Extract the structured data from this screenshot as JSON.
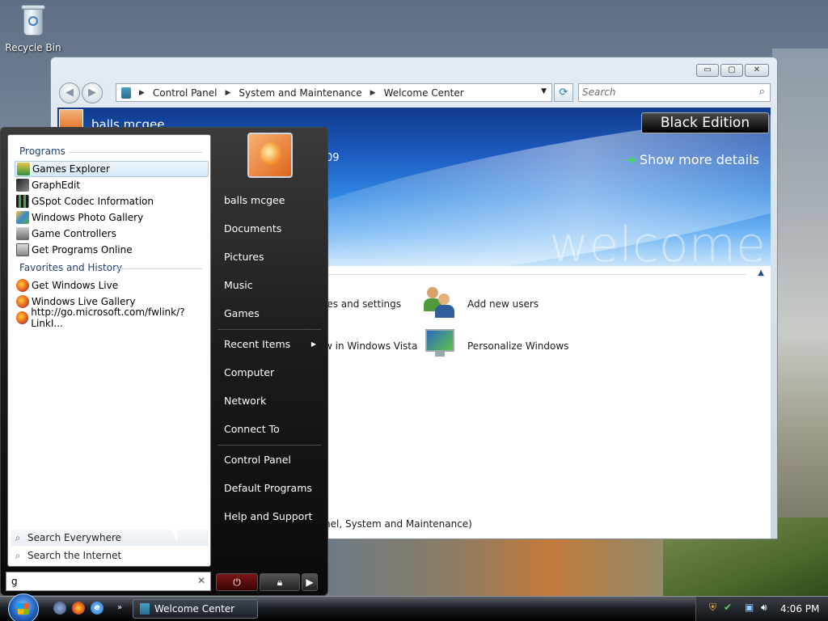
{
  "desktop": {
    "recycle_bin_label": "Recycle Bin"
  },
  "window": {
    "title": "Welcome Center",
    "controls": {
      "minimize": "▭",
      "maximize": "▢",
      "close": "✕"
    },
    "address": {
      "crumbs": [
        "Control Panel",
        "System and Maintenance",
        "Welcome Center"
      ]
    },
    "search_placeholder": "Search",
    "banner": {
      "user_name": "balls mcgee",
      "edition": "Black Edition",
      "partial_year": "09",
      "show_more": "Show more details",
      "watermark": "welcome"
    },
    "tasks": [
      {
        "label": "les and settings"
      },
      {
        "label": "Add new users"
      },
      {
        "label": "w in Windows Vista"
      },
      {
        "label": "Personalize Windows"
      }
    ],
    "footer_text": "nel, System and Maintenance)"
  },
  "start_menu": {
    "programs_header": "Programs",
    "programs": [
      {
        "label": "Games Explorer",
        "icon": "games-explorer-icon",
        "color": "#2f8f3a"
      },
      {
        "label": "GraphEdit",
        "icon": "graphedit-icon",
        "color": "#555555"
      },
      {
        "label": "GSpot Codec Information",
        "icon": "gspot-icon",
        "color": "#3a7d3a"
      },
      {
        "label": "Windows Photo Gallery",
        "icon": "photo-gallery-icon",
        "color": "#3c86c9"
      },
      {
        "label": "Game Controllers",
        "icon": "game-controller-icon",
        "color": "#7a7a7a"
      },
      {
        "label": "Get Programs Online",
        "icon": "programs-online-icon",
        "color": "#8c8c8c"
      }
    ],
    "favorites_header": "Favorites and History",
    "favorites": [
      {
        "label": "Get Windows Live",
        "icon": "firefox-icon"
      },
      {
        "label": "Windows Live Gallery",
        "icon": "firefox-icon"
      },
      {
        "label": "http://go.microsoft.com/fwlink/?LinkI...",
        "icon": "firefox-icon"
      }
    ],
    "search_everywhere": "Search Everywhere",
    "search_internet": "Search the Internet",
    "search_value": "g",
    "right_items": [
      "balls mcgee",
      "Documents",
      "Pictures",
      "Music",
      "Games",
      "Recent Items",
      "Computer",
      "Network",
      "Connect To",
      "Control Panel",
      "Default Programs",
      "Help and Support"
    ]
  },
  "taskbar": {
    "active_window": "Welcome Center",
    "quicklaunch_more": "»",
    "clock": "4:06 PM"
  }
}
